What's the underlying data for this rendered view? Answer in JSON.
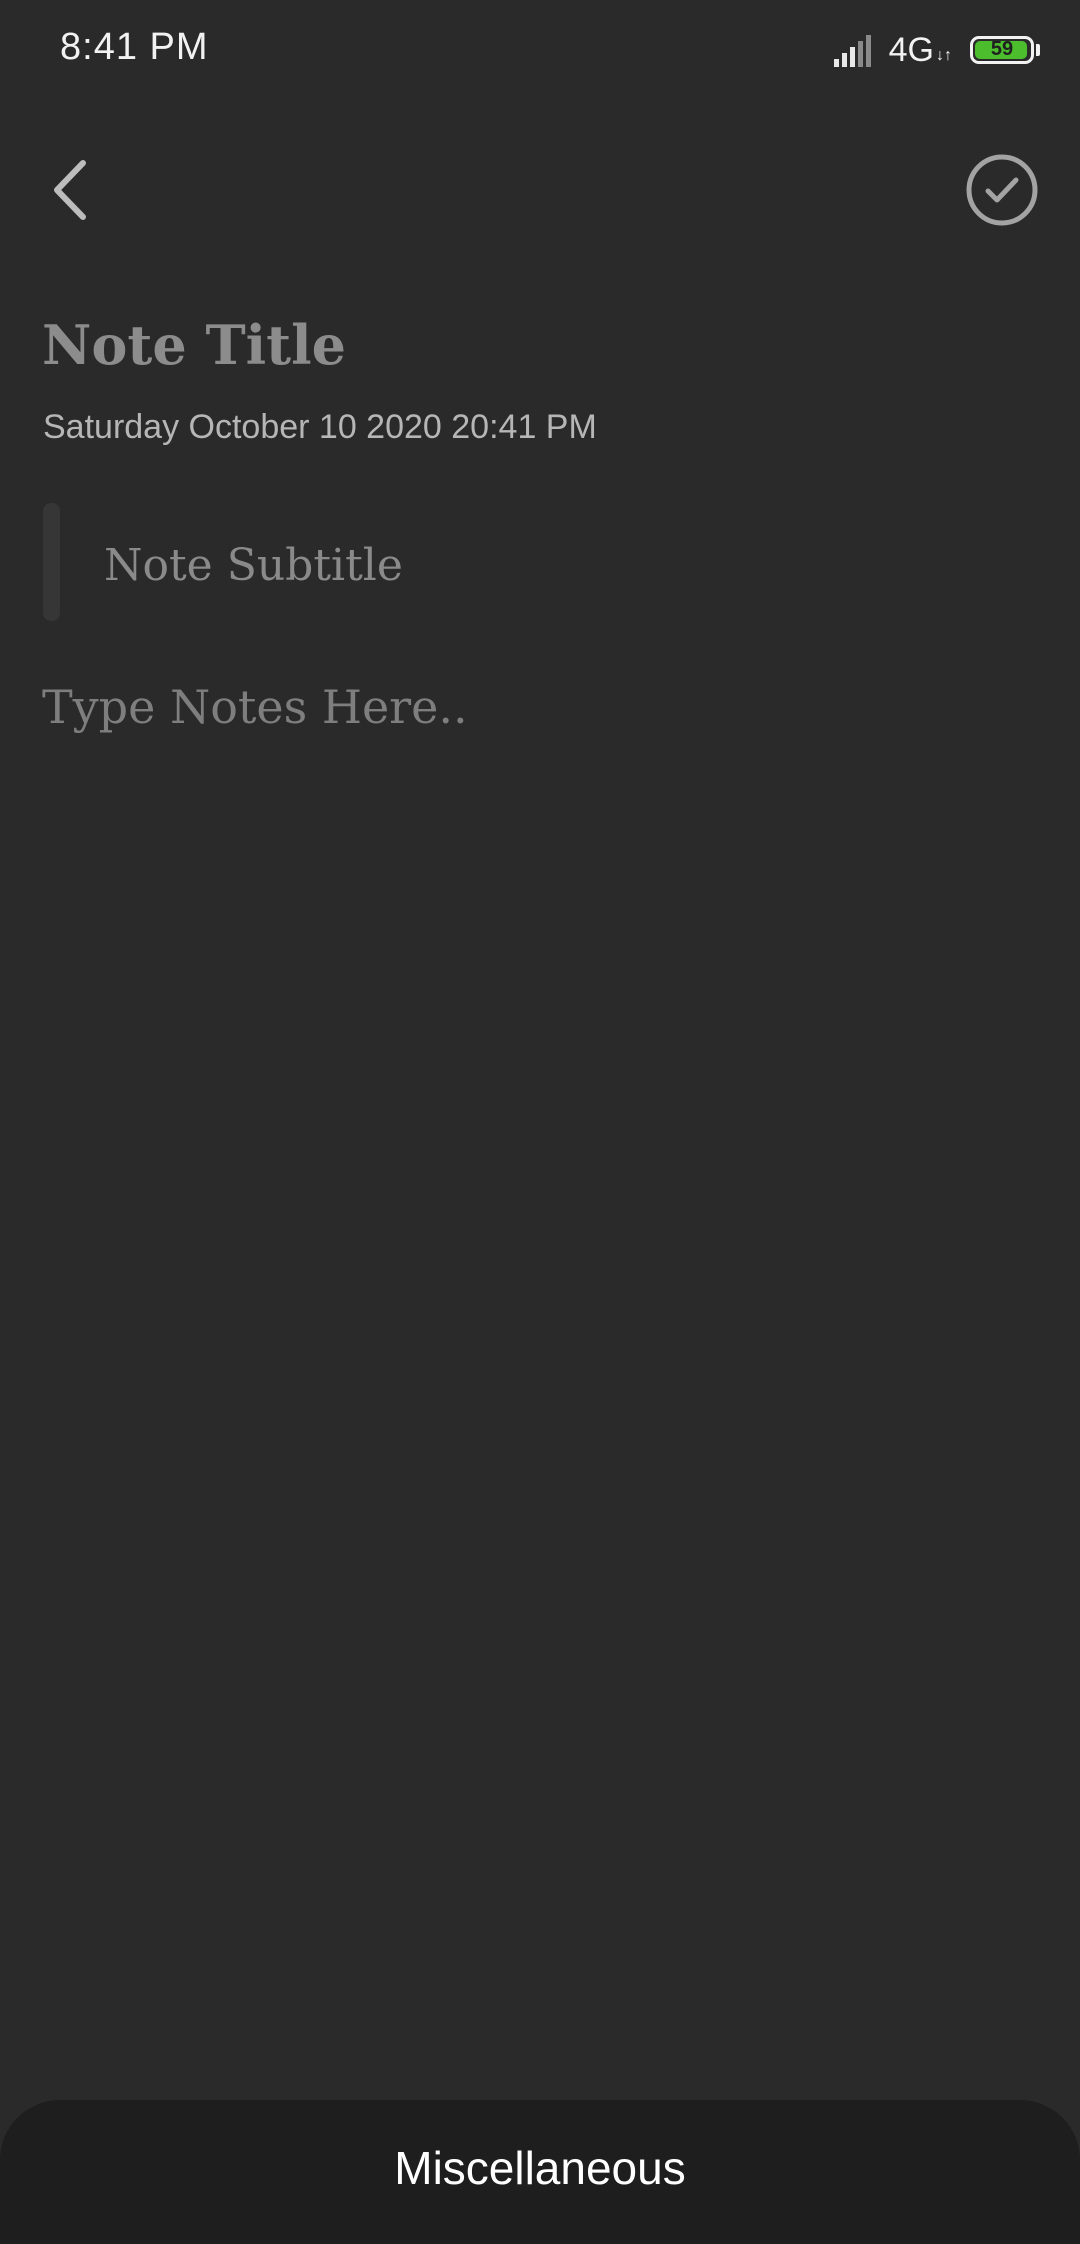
{
  "status_bar": {
    "time": "8:41  PM",
    "network": "4G",
    "battery_level": "59",
    "battery_color": "#4cbe2e"
  },
  "toolbar": {
    "back_icon": "chevron-left-icon",
    "done_icon": "check-circle-icon"
  },
  "note": {
    "title_placeholder": "Note Title",
    "date_time": "Saturday October 10 2020 20:41 PM",
    "subtitle_placeholder": "Note Subtitle",
    "body_placeholder": "Type Notes Here.."
  },
  "bottom_sheet": {
    "label": "Miscellaneous"
  },
  "colors": {
    "background": "#2a2a2a",
    "sheet_background": "#1e1e1e",
    "placeholder_text": "#8c8c8c"
  }
}
